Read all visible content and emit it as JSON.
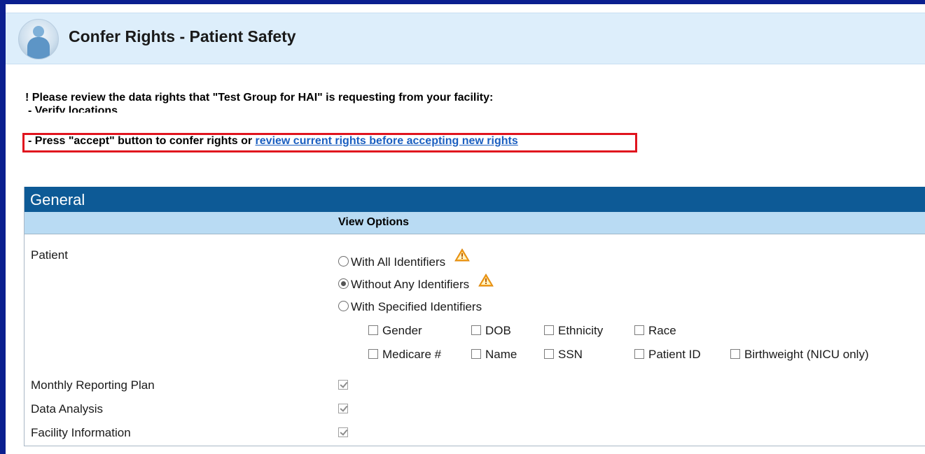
{
  "header": {
    "title": "Confer Rights - Patient Safety"
  },
  "notice": {
    "line1": "! Please review the data rights that \"Test Group for HAI\" is requesting from your facility:",
    "line2": "- Verify locations",
    "line3_prefix": "- Press \"accept\" button to confer rights or ",
    "line3_link": "review current rights before accepting new rights"
  },
  "section": {
    "title": "General",
    "column_header": "View Options",
    "rows": {
      "patient": "Patient",
      "monthly_reporting_plan": "Monthly Reporting Plan",
      "data_analysis": "Data Analysis",
      "facility_information": "Facility Information"
    },
    "patient_options": {
      "with_all": "With All Identifiers",
      "without_any": "Without Any Identifiers",
      "with_specified": "With Specified Identifiers",
      "selected": "without_any"
    },
    "identifiers": {
      "gender": "Gender",
      "dob": "DOB",
      "ethnicity": "Ethnicity",
      "race": "Race",
      "medicare": "Medicare #",
      "name": "Name",
      "ssn": "SSN",
      "patient_id": "Patient ID",
      "birthweight": "Birthweight (NICU only)"
    },
    "checked_rows": [
      "monthly_reporting_plan",
      "data_analysis",
      "facility_information"
    ]
  },
  "icons": {
    "avatar": "clinician-avatar-icon",
    "warning": "warning-icon"
  },
  "colors": {
    "background": "#0b1f8f",
    "header_bg": "#ddeefb",
    "section_title_bg": "#0d5a96",
    "column_header_bg": "#b9dbf3",
    "highlight": "#e0141e",
    "link": "#1b5fc0"
  }
}
